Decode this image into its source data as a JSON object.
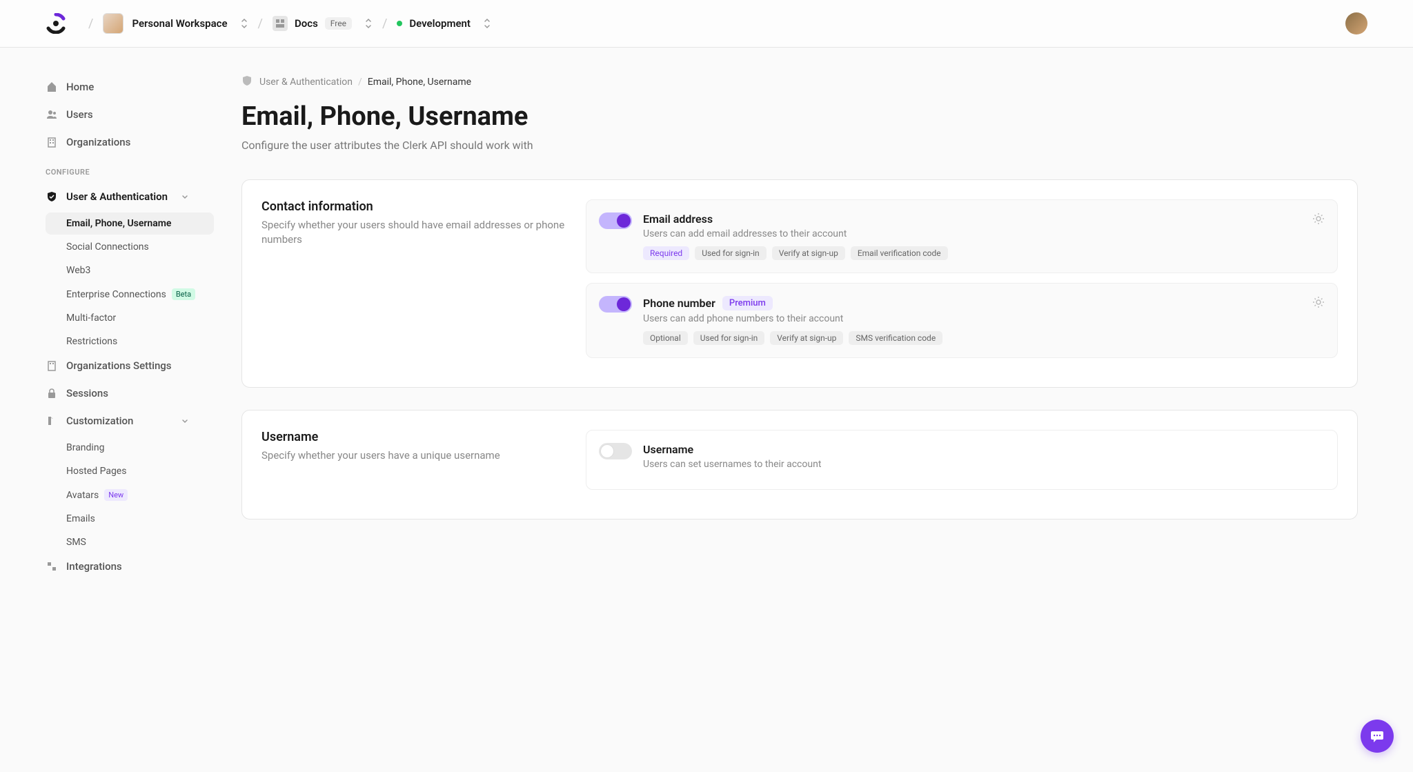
{
  "header": {
    "workspace_name": "Personal Workspace",
    "app_name": "Docs",
    "app_badge": "Free",
    "env_name": "Development"
  },
  "sidebar": {
    "main_items": [
      {
        "label": "Home",
        "icon": "home"
      },
      {
        "label": "Users",
        "icon": "users"
      },
      {
        "label": "Organizations",
        "icon": "building"
      }
    ],
    "configure_header": "CONFIGURE",
    "user_auth": {
      "label": "User & Authentication",
      "items": [
        {
          "label": "Email, Phone, Username",
          "active": true
        },
        {
          "label": "Social Connections"
        },
        {
          "label": "Web3"
        },
        {
          "label": "Enterprise Connections",
          "badge": "Beta",
          "badge_type": "beta"
        },
        {
          "label": "Multi-factor"
        },
        {
          "label": "Restrictions"
        }
      ]
    },
    "other_items": [
      {
        "label": "Organizations Settings",
        "icon": "building"
      },
      {
        "label": "Sessions",
        "icon": "lock"
      }
    ],
    "customization": {
      "label": "Customization",
      "items": [
        {
          "label": "Branding"
        },
        {
          "label": "Hosted Pages"
        },
        {
          "label": "Avatars",
          "badge": "New",
          "badge_type": "new"
        },
        {
          "label": "Emails"
        },
        {
          "label": "SMS"
        }
      ]
    },
    "integrations_label": "Integrations"
  },
  "breadcrumb": {
    "parent": "User & Authentication",
    "current": "Email, Phone, Username"
  },
  "page": {
    "title": "Email, Phone, Username",
    "subtitle": "Configure the user attributes the Clerk API should work with"
  },
  "contact_section": {
    "title": "Contact information",
    "desc": "Specify whether your users should have email addresses or phone numbers",
    "email": {
      "title": "Email address",
      "desc": "Users can add email addresses to their account",
      "tags": [
        "Required",
        "Used for sign-in",
        "Verify at sign-up",
        "Email verification code"
      ]
    },
    "phone": {
      "title": "Phone number",
      "premium": "Premium",
      "desc": "Users can add phone numbers to their account",
      "tags": [
        "Optional",
        "Used for sign-in",
        "Verify at sign-up",
        "SMS verification code"
      ]
    }
  },
  "username_section": {
    "title": "Username",
    "desc": "Specify whether your users have a unique username",
    "option": {
      "title": "Username",
      "desc": "Users can set usernames to their account"
    }
  }
}
